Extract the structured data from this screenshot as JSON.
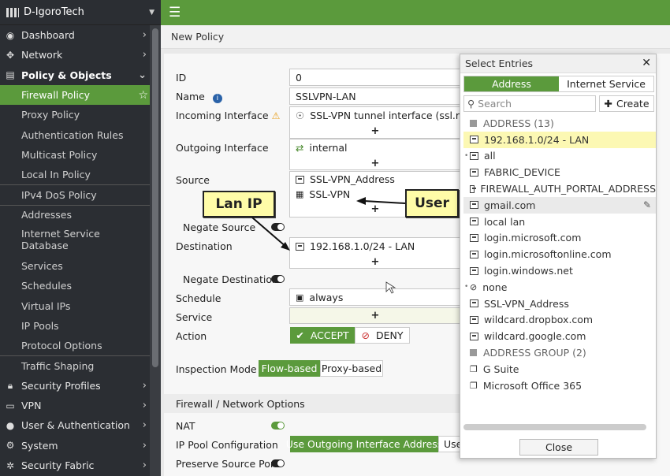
{
  "sidebar": {
    "brand": "D-IgoroTech",
    "items": [
      {
        "label": "Dashboard",
        "icon": "dashboard-icon",
        "type": "top"
      },
      {
        "label": "Network",
        "icon": "network-icon",
        "type": "top"
      },
      {
        "label": "Policy & Objects",
        "icon": "policy-icon",
        "type": "top-open"
      },
      {
        "label": "Firewall Policy",
        "type": "active"
      },
      {
        "label": "Proxy Policy",
        "type": "sub"
      },
      {
        "label": "Authentication Rules",
        "type": "sub"
      },
      {
        "label": "Multicast Policy",
        "type": "sub"
      },
      {
        "label": "Local In Policy",
        "type": "sub"
      },
      {
        "label": "IPv4 DoS Policy",
        "type": "sub"
      },
      {
        "label": "Addresses",
        "type": "sub"
      },
      {
        "label": "Internet Service Database",
        "type": "sub2"
      },
      {
        "label": "Services",
        "type": "sub"
      },
      {
        "label": "Schedules",
        "type": "sub"
      },
      {
        "label": "Virtual IPs",
        "type": "sub"
      },
      {
        "label": "IP Pools",
        "type": "sub"
      },
      {
        "label": "Protocol Options",
        "type": "sub"
      },
      {
        "label": "Traffic Shaping",
        "type": "sub"
      },
      {
        "label": "Security Profiles",
        "icon": "lock-icon",
        "type": "top"
      },
      {
        "label": "VPN",
        "icon": "monitor-icon",
        "type": "top"
      },
      {
        "label": "User & Authentication",
        "icon": "user-icon",
        "type": "top"
      },
      {
        "label": "System",
        "icon": "gear-icon",
        "type": "top"
      },
      {
        "label": "Security Fabric",
        "icon": "fabric-icon",
        "type": "top"
      }
    ]
  },
  "header": {
    "title": "New Policy"
  },
  "form": {
    "id_label": "ID",
    "id_value": "0",
    "name_label": "Name",
    "name_value": "SSLVPN-LAN",
    "incoming_label": "Incoming Interface",
    "incoming_value": "SSL-VPN tunnel interface (ssl.roo",
    "outgoing_label": "Outgoing Interface",
    "outgoing_value": "internal",
    "source_label": "Source",
    "source_values": [
      "SSL-VPN_Address",
      "SSL-VPN"
    ],
    "negate_source_label": "Negate Source",
    "destination_label": "Destination",
    "destination_value": "192.168.1.0/24 - LAN",
    "negate_destination_label": "Negate Destination",
    "schedule_label": "Schedule",
    "schedule_value": "always",
    "service_label": "Service",
    "action_label": "Action",
    "accept_label": "ACCEPT",
    "deny_label": "DENY",
    "inspection_label": "Inspection Mode",
    "flow_label": "Flow-based",
    "proxy_label": "Proxy-based",
    "section_title": "Firewall / Network Options",
    "nat_label": "NAT",
    "ippool_label": "IP Pool Configuration",
    "ippool_value": "Use Outgoing Interface Address",
    "ippool_other": "Use",
    "preserve_label": "Preserve Source Port",
    "plus": "+"
  },
  "callouts": {
    "lan_ip": "Lan IP",
    "user": "User"
  },
  "panel": {
    "title": "Select Entries",
    "tab_address": "Address",
    "tab_internet": "Internet Service",
    "search_placeholder": "Search",
    "create_label": "Create",
    "group1": "ADDRESS (13)",
    "group2": "ADDRESS GROUP (2)",
    "addresses": [
      "192.168.1.0/24 - LAN",
      "all",
      "FABRIC_DEVICE",
      "FIREWALL_AUTH_PORTAL_ADDRESS",
      "gmail.com",
      "local lan",
      "login.microsoft.com",
      "login.microsoftonline.com",
      "login.windows.net",
      "none",
      "SSL-VPN_Address",
      "wildcard.dropbox.com",
      "wildcard.google.com"
    ],
    "groups": [
      "G Suite",
      "Microsoft Office 365"
    ],
    "close_label": "Close"
  },
  "colors": {
    "accent": "#5b9a3c",
    "sidebar": "#2b2e33",
    "highlight": "#fcf8b3"
  }
}
